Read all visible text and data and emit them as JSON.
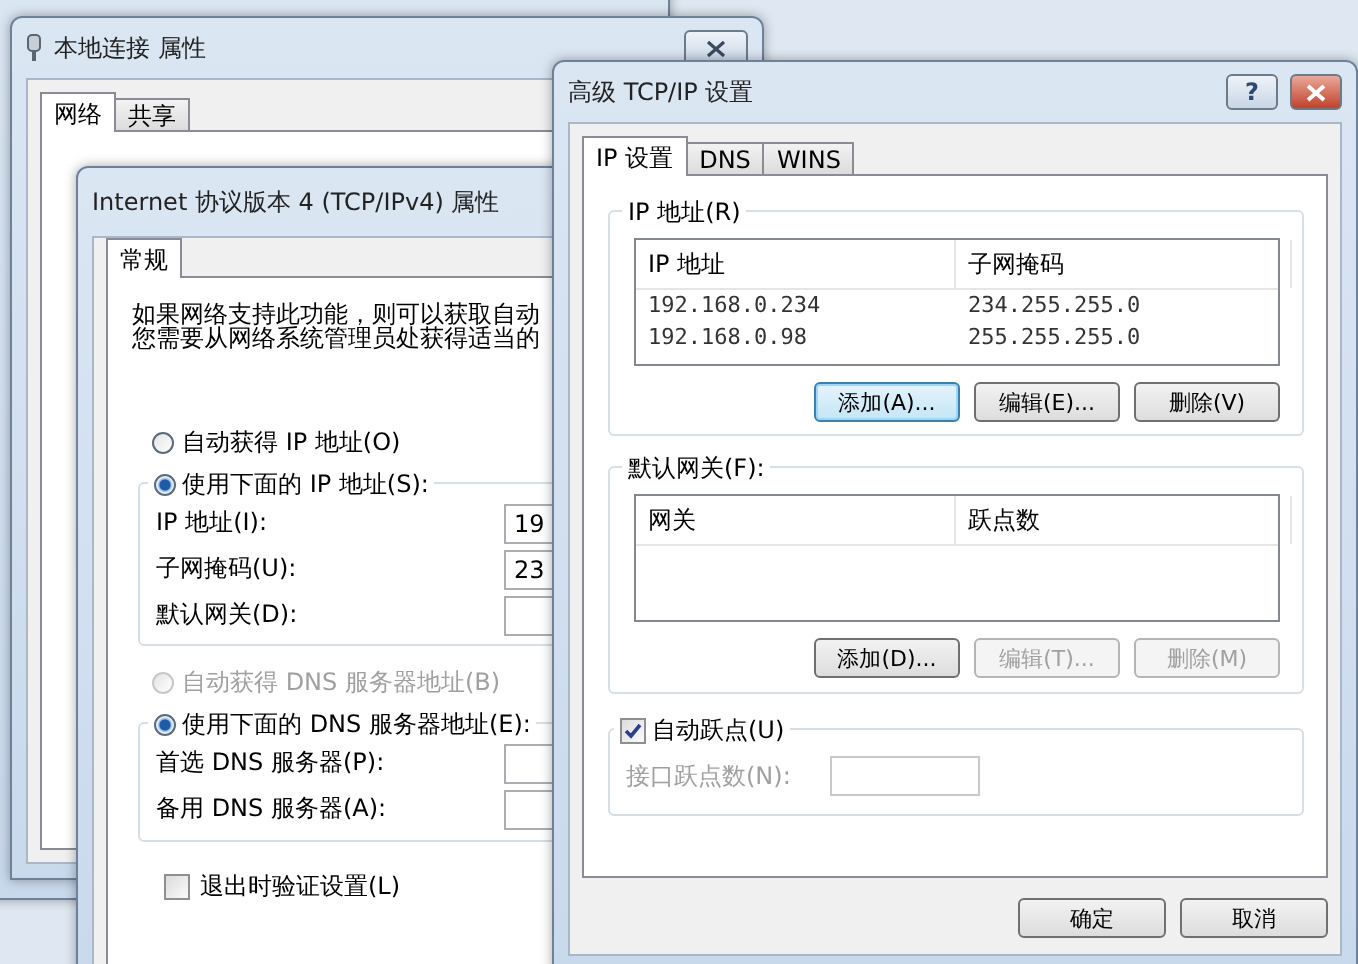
{
  "local_connection_properties": {
    "title": "本地连接 属性",
    "tabs": [
      {
        "label": "网络",
        "selected": true
      },
      {
        "label": "共享",
        "selected": false
      }
    ]
  },
  "ipv4_properties": {
    "title": "Internet 协议版本 4 (TCP/IPv4) 属性",
    "tabs": [
      {
        "label": "常规",
        "selected": true
      }
    ],
    "intro": [
      "如果网络支持此功能，则可以获取自动",
      "您需要从网络系统管理员处获得适当的"
    ],
    "ip_mode": [
      {
        "label": "自动获得 IP 地址(O)",
        "selected": false,
        "disabled": false
      },
      {
        "label": "使用下面的 IP 地址(S):",
        "selected": true,
        "disabled": false
      }
    ],
    "ip_fields": [
      {
        "label": "IP 地址(I):",
        "value": "19"
      },
      {
        "label": "子网掩码(U):",
        "value": "23"
      },
      {
        "label": "默认网关(D):"
      }
    ],
    "dns_mode": [
      {
        "label": "自动获得 DNS 服务器地址(B)",
        "selected": false,
        "disabled": true
      },
      {
        "label": "使用下面的 DNS 服务器地址(E):",
        "selected": true,
        "disabled": false
      }
    ],
    "dns_fields": [
      {
        "label": "首选 DNS 服务器(P):"
      },
      {
        "label": "备用 DNS 服务器(A):"
      }
    ],
    "validate": {
      "label": "退出时验证设置(L)",
      "checked": false
    }
  },
  "advanced_tcpip": {
    "title": "高级 TCP/IP 设置",
    "help_button": "?",
    "tabs": [
      {
        "label": "IP 设置",
        "selected": true
      },
      {
        "label": "DNS",
        "selected": false
      },
      {
        "label": "WINS",
        "selected": false
      }
    ],
    "ip_group": {
      "title": "IP 地址(R)",
      "columns": [
        "IP 地址",
        "子网掩码"
      ],
      "rows": [
        [
          "192.168.0.234",
          "234.255.255.0"
        ],
        [
          "192.168.0.98",
          "255.255.255.0"
        ]
      ],
      "buttons": [
        {
          "label": "添加(A)...",
          "disabled": false,
          "focused": true
        },
        {
          "label": "编辑(E)...",
          "disabled": false,
          "focused": false
        },
        {
          "label": "删除(V)",
          "disabled": false,
          "focused": false
        }
      ]
    },
    "gateway_group": {
      "title": "默认网关(F):",
      "columns": [
        "网关",
        "跃点数"
      ],
      "buttons": [
        {
          "label": "添加(D)...",
          "disabled": false,
          "focused": false
        },
        {
          "label": "编辑(T)...",
          "disabled": true,
          "focused": false
        },
        {
          "label": "删除(M)",
          "disabled": true,
          "focused": false
        }
      ]
    },
    "auto_metric": {
      "label": "自动跃点(U)",
      "checked": true
    },
    "metric_field": {
      "label": "接口跃点数(N):",
      "disabled": true
    },
    "buttons": [
      "确定",
      "取消"
    ]
  }
}
